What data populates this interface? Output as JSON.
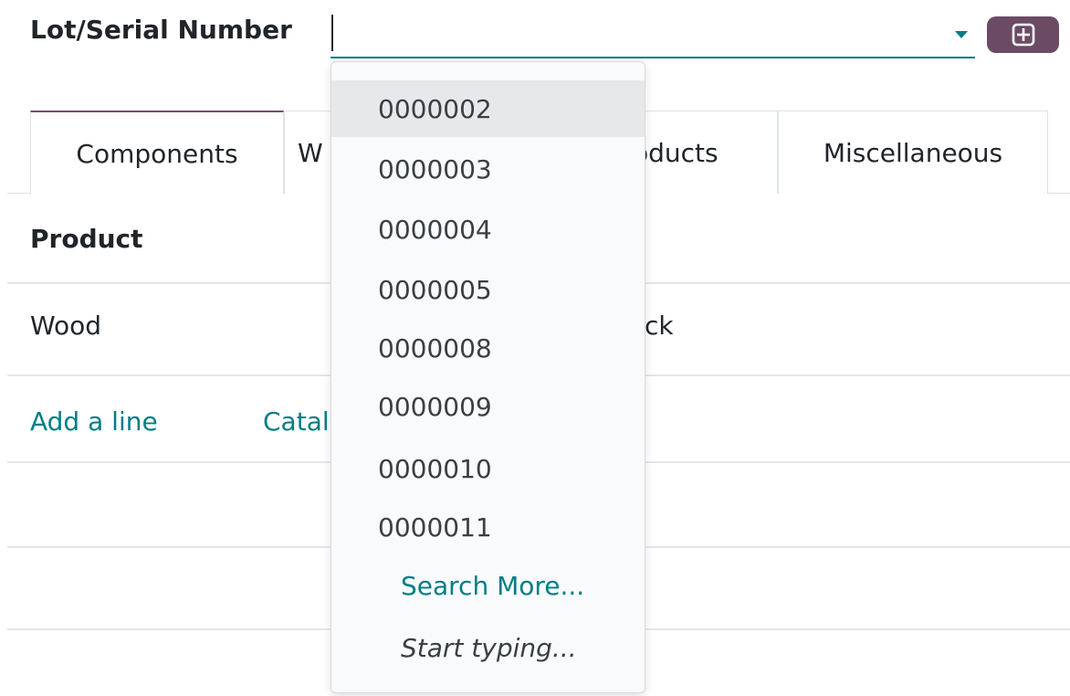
{
  "field": {
    "label": "Lot/Serial Number",
    "value": "",
    "placeholder": ""
  },
  "tabs": [
    {
      "label": "Components"
    },
    {
      "label": "W"
    },
    {
      "label": "oducts"
    },
    {
      "label": "Miscellaneous"
    }
  ],
  "table": {
    "header": "Product",
    "row": {
      "product": "Wood",
      "partial": "ck"
    },
    "add_line": "Add a line",
    "catalog_partial": "Catal"
  },
  "dropdown": {
    "items": [
      "0000002",
      "0000003",
      "0000004",
      "0000005",
      "0000008",
      "0000009",
      "0000010",
      "0000011"
    ],
    "search_more": "Search More...",
    "start_typing": "Start typing..."
  },
  "colors": {
    "accent": "#017e84",
    "brand": "#714b67",
    "button": "#6b4b64"
  }
}
